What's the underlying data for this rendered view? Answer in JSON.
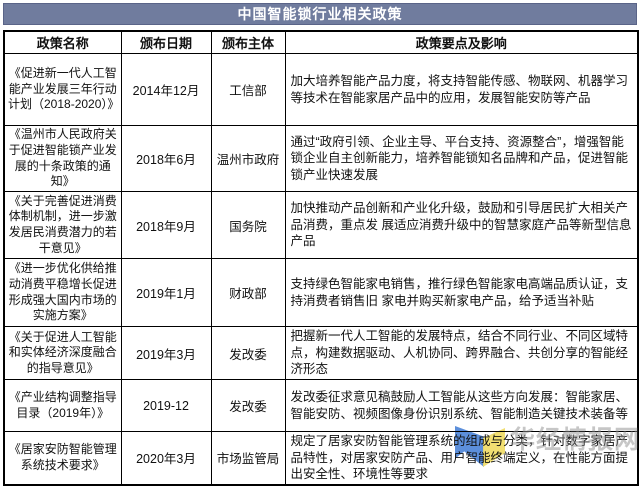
{
  "title": "中国智能锁行业相关政策",
  "table": {
    "headers": [
      "政策名称",
      "颁布日期",
      "颁布主体",
      "政策要点及影响"
    ],
    "rows": [
      {
        "name": "《促进新一代人工智能产业发展三年行动计划（2018-2020）》",
        "date": "2014年12月",
        "issuer": "工信部",
        "points": "加大培养智能产品力度，将支持智能传感、物联网、机器学习等技术在智能家居产品中的应用，发展智能安防等产品"
      },
      {
        "name": "《温州市人民政府关于促进智能锁产业发展的十条政策的通知》",
        "date": "2018年6月",
        "issuer": "温州市政府",
        "points": "通过“政府引领、企业主导、平台支持、资源整合”，增强智能锁企业自主创新能力，培养智能锁知名品牌和产品，促进智能锁产业快速发展"
      },
      {
        "name": "《关于完善促进消费体制机制，进一步激发居民消费潜力的若干意见》",
        "date": "2018年9月",
        "issuer": "国务院",
        "points": "加快推动产品创新和产业化升级，鼓励和引导居民扩大相关产品消费，重点发 展适应消费升级中的智慧家庭产品等新型信息产品"
      },
      {
        "name": "《进一步优化供给推动消费平稳增长促进形成强大国内市场的实施方案》",
        "date": "2019年1月",
        "issuer": "财政部",
        "points": "支持绿色智能家电销售，推行绿色智能家电高端品质认证，支持消费者销售旧 家电并购买新家电产品，给予适当补贴"
      },
      {
        "name": "《关于促进人工智能和实体经济深度融合的指导意见》",
        "date": "2019年3月",
        "issuer": "发改委",
        "points": "把握新一代人工智能的发展特点，结合不同行业、不同区域特点，构建数据驱动、人机协同、跨界融合、共创分享的智能经济形态"
      },
      {
        "name": "《产业结构调整指导目录（2019年）》",
        "date": "2019-12",
        "issuer": "发改委",
        "points": "发改委征求意见稿鼓励人工智能从这些方向发展：智能家居、智能安防、视频图像身份识别系统、智能制造关键技术装备等"
      },
      {
        "name": "《居家安防智能管理系统技术要求》",
        "date": "2020年3月",
        "issuer": "市场监管局",
        "points": "规定了居家安防智能管理系统的组成与分类，针对数字家居产品特性，对居家安防产品、用户智能终端定义，在性能方面提出安全性、环境性等要求"
      }
    ]
  },
  "watermark": {
    "text": "华经情报网"
  },
  "colors": {
    "title_bg": "#707c9e",
    "title_text": "#ffffff",
    "border": "#000000",
    "logo_blue": "#4e86d8",
    "logo_yellow": "#f0dc66",
    "watermark_gray": "#8f8f8f"
  }
}
